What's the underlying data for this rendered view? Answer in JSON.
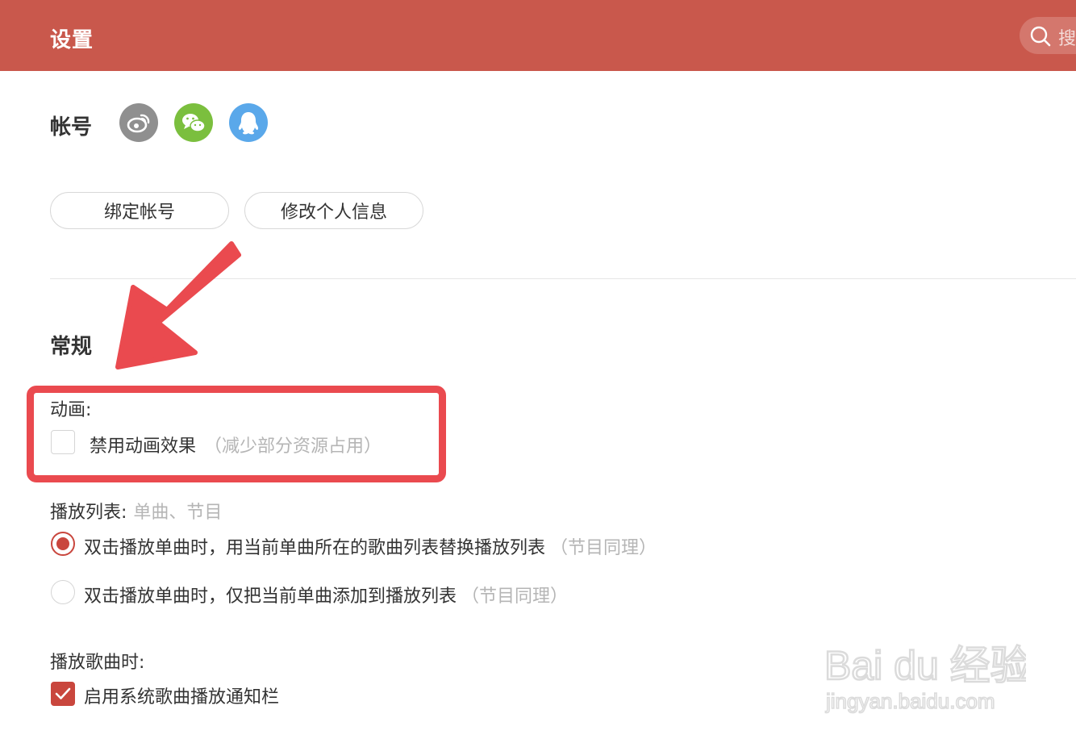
{
  "header": {
    "title": "设置",
    "search_text": "搜"
  },
  "account": {
    "title": "帐号",
    "social": [
      {
        "name": "weibo",
        "color": "#8f8f8f"
      },
      {
        "name": "wechat",
        "color": "#7bbf3e"
      },
      {
        "name": "qq",
        "color": "#5aa8ea"
      }
    ],
    "bind_button": "绑定帐号",
    "edit_button": "修改个人信息"
  },
  "general": {
    "title": "常规",
    "animation": {
      "label": "动画:",
      "checkbox_label": "禁用动画效果",
      "checkbox_hint": "（减少部分资源占用）",
      "checked": false
    },
    "playlist": {
      "label": "播放列表:",
      "label_hint": "单曲、节目",
      "options": [
        {
          "text": "双击播放单曲时，用当前单曲所在的歌曲列表替换播放列表",
          "hint": "（节目同理）",
          "selected": true
        },
        {
          "text": "双击播放单曲时，仅把当前单曲添加到播放列表",
          "hint": "（节目同理）",
          "selected": false
        }
      ]
    },
    "playing": {
      "label": "播放歌曲时:",
      "checkbox_label": "启用系统歌曲播放通知栏",
      "checked": true
    }
  },
  "watermark": {
    "brand": "Bai du 经验",
    "url": "jingyan.baidu.com"
  },
  "colors": {
    "header": "#c9584c",
    "accent": "#c9463d",
    "annotation": "#ea4a4f"
  }
}
